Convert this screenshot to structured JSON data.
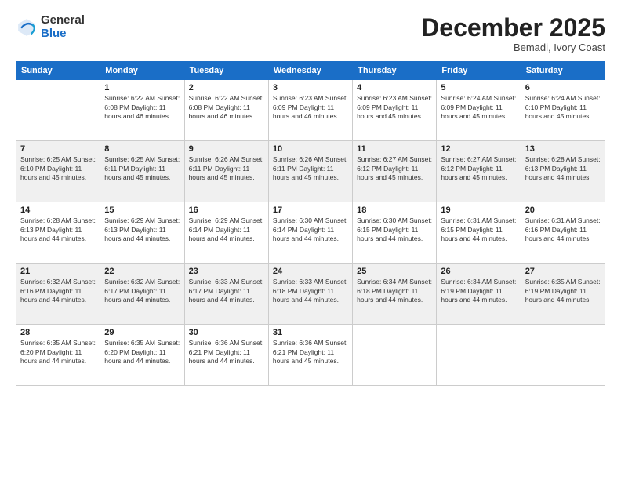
{
  "logo": {
    "general": "General",
    "blue": "Blue"
  },
  "title": "December 2025",
  "location": "Bemadi, Ivory Coast",
  "weekdays": [
    "Sunday",
    "Monday",
    "Tuesday",
    "Wednesday",
    "Thursday",
    "Friday",
    "Saturday"
  ],
  "rows": [
    [
      {
        "day": "",
        "info": ""
      },
      {
        "day": "1",
        "info": "Sunrise: 6:22 AM\nSunset: 6:08 PM\nDaylight: 11 hours\nand 46 minutes."
      },
      {
        "day": "2",
        "info": "Sunrise: 6:22 AM\nSunset: 6:08 PM\nDaylight: 11 hours\nand 46 minutes."
      },
      {
        "day": "3",
        "info": "Sunrise: 6:23 AM\nSunset: 6:09 PM\nDaylight: 11 hours\nand 46 minutes."
      },
      {
        "day": "4",
        "info": "Sunrise: 6:23 AM\nSunset: 6:09 PM\nDaylight: 11 hours\nand 45 minutes."
      },
      {
        "day": "5",
        "info": "Sunrise: 6:24 AM\nSunset: 6:09 PM\nDaylight: 11 hours\nand 45 minutes."
      },
      {
        "day": "6",
        "info": "Sunrise: 6:24 AM\nSunset: 6:10 PM\nDaylight: 11 hours\nand 45 minutes."
      }
    ],
    [
      {
        "day": "7",
        "info": "Sunrise: 6:25 AM\nSunset: 6:10 PM\nDaylight: 11 hours\nand 45 minutes."
      },
      {
        "day": "8",
        "info": "Sunrise: 6:25 AM\nSunset: 6:11 PM\nDaylight: 11 hours\nand 45 minutes."
      },
      {
        "day": "9",
        "info": "Sunrise: 6:26 AM\nSunset: 6:11 PM\nDaylight: 11 hours\nand 45 minutes."
      },
      {
        "day": "10",
        "info": "Sunrise: 6:26 AM\nSunset: 6:11 PM\nDaylight: 11 hours\nand 45 minutes."
      },
      {
        "day": "11",
        "info": "Sunrise: 6:27 AM\nSunset: 6:12 PM\nDaylight: 11 hours\nand 45 minutes."
      },
      {
        "day": "12",
        "info": "Sunrise: 6:27 AM\nSunset: 6:12 PM\nDaylight: 11 hours\nand 45 minutes."
      },
      {
        "day": "13",
        "info": "Sunrise: 6:28 AM\nSunset: 6:13 PM\nDaylight: 11 hours\nand 44 minutes."
      }
    ],
    [
      {
        "day": "14",
        "info": "Sunrise: 6:28 AM\nSunset: 6:13 PM\nDaylight: 11 hours\nand 44 minutes."
      },
      {
        "day": "15",
        "info": "Sunrise: 6:29 AM\nSunset: 6:13 PM\nDaylight: 11 hours\nand 44 minutes."
      },
      {
        "day": "16",
        "info": "Sunrise: 6:29 AM\nSunset: 6:14 PM\nDaylight: 11 hours\nand 44 minutes."
      },
      {
        "day": "17",
        "info": "Sunrise: 6:30 AM\nSunset: 6:14 PM\nDaylight: 11 hours\nand 44 minutes."
      },
      {
        "day": "18",
        "info": "Sunrise: 6:30 AM\nSunset: 6:15 PM\nDaylight: 11 hours\nand 44 minutes."
      },
      {
        "day": "19",
        "info": "Sunrise: 6:31 AM\nSunset: 6:15 PM\nDaylight: 11 hours\nand 44 minutes."
      },
      {
        "day": "20",
        "info": "Sunrise: 6:31 AM\nSunset: 6:16 PM\nDaylight: 11 hours\nand 44 minutes."
      }
    ],
    [
      {
        "day": "21",
        "info": "Sunrise: 6:32 AM\nSunset: 6:16 PM\nDaylight: 11 hours\nand 44 minutes."
      },
      {
        "day": "22",
        "info": "Sunrise: 6:32 AM\nSunset: 6:17 PM\nDaylight: 11 hours\nand 44 minutes."
      },
      {
        "day": "23",
        "info": "Sunrise: 6:33 AM\nSunset: 6:17 PM\nDaylight: 11 hours\nand 44 minutes."
      },
      {
        "day": "24",
        "info": "Sunrise: 6:33 AM\nSunset: 6:18 PM\nDaylight: 11 hours\nand 44 minutes."
      },
      {
        "day": "25",
        "info": "Sunrise: 6:34 AM\nSunset: 6:18 PM\nDaylight: 11 hours\nand 44 minutes."
      },
      {
        "day": "26",
        "info": "Sunrise: 6:34 AM\nSunset: 6:19 PM\nDaylight: 11 hours\nand 44 minutes."
      },
      {
        "day": "27",
        "info": "Sunrise: 6:35 AM\nSunset: 6:19 PM\nDaylight: 11 hours\nand 44 minutes."
      }
    ],
    [
      {
        "day": "28",
        "info": "Sunrise: 6:35 AM\nSunset: 6:20 PM\nDaylight: 11 hours\nand 44 minutes."
      },
      {
        "day": "29",
        "info": "Sunrise: 6:35 AM\nSunset: 6:20 PM\nDaylight: 11 hours\nand 44 minutes."
      },
      {
        "day": "30",
        "info": "Sunrise: 6:36 AM\nSunset: 6:21 PM\nDaylight: 11 hours\nand 44 minutes."
      },
      {
        "day": "31",
        "info": "Sunrise: 6:36 AM\nSunset: 6:21 PM\nDaylight: 11 hours\nand 45 minutes."
      },
      {
        "day": "",
        "info": ""
      },
      {
        "day": "",
        "info": ""
      },
      {
        "day": "",
        "info": ""
      }
    ]
  ],
  "row_shaded": [
    false,
    true,
    false,
    true,
    false
  ]
}
